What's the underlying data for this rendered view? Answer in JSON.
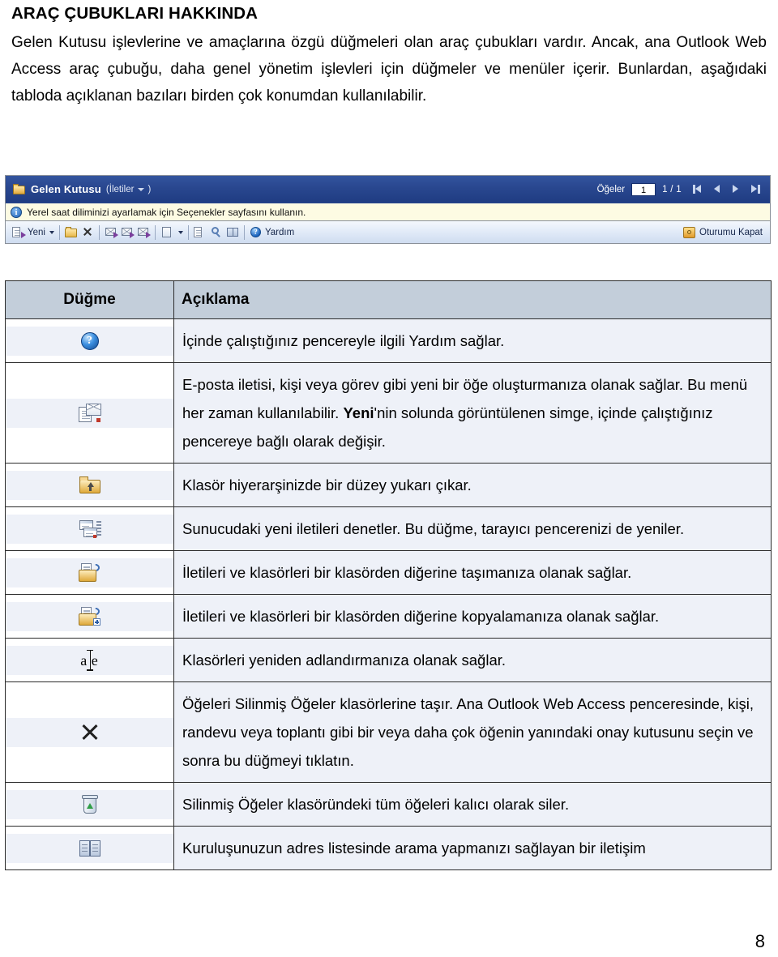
{
  "document": {
    "heading": "ARAÇ ÇUBUKLARI HAKKINDA",
    "paragraph": "Gelen Kutusu işlevlerine ve amaçlarına özgü düğmeleri olan araç çubukları vardır. Ancak, ana Outlook Web Access araç çubuğu, daha genel yönetim işlevleri için düğmeler ve menüler içerir. Bunlardan, aşağıdaki tabloda açıklanan bazıları birden çok konumdan kullanılabilir.",
    "page_number": "8"
  },
  "owa_screenshot": {
    "titlebar": {
      "folder_icon": "folder-icon",
      "title": "Gelen Kutusu",
      "view_label": "(İletiler",
      "view_close": ")",
      "items_label": "Öğeler",
      "items_value": "1",
      "page_count": "1 / 1",
      "nav_first": "first-page-button",
      "nav_prev": "previous-page-button",
      "nav_next": "next-page-button",
      "nav_last": "last-page-button"
    },
    "infobar": {
      "icon": "info-icon",
      "text": "Yerel saat diliminizi ayarlamak için Seçenekler sayfasını kullanın."
    },
    "toolbar": {
      "new_label": "Yeni",
      "help_label": "Yardım",
      "signout_label": "Oturumu Kapat",
      "buttons": [
        "new-item-button",
        "new-dropdown-caret",
        "move-to-folder-button",
        "delete-button",
        "reply-button",
        "reply-all-button",
        "forward-button",
        "reading-pane-button",
        "reading-pane-caret",
        "check-messages-button",
        "find-button",
        "address-book-button",
        "help-button"
      ]
    }
  },
  "table": {
    "headers": {
      "button": "Düğme",
      "description": "Açıklama"
    },
    "rows": [
      {
        "icon": "help-icon",
        "description": "İçinde çalıştığınız pencereyle ilgili Yardım sağlar.",
        "bold_term": "",
        "description_after_bold": ""
      },
      {
        "icon": "new-item-icon",
        "description": "E-posta iletisi, kişi veya görev gibi yeni bir öğe oluşturmanıza olanak sağlar. Bu menü her zaman kullanılabilir. ",
        "bold_term": "Yeni",
        "description_after_bold": "'nin solunda görüntülenen simge, içinde çalıştığınız pencereye bağlı olarak değişir."
      },
      {
        "icon": "folder-up-icon",
        "description": "Klasör hiyerarşinizde bir düzey yukarı çıkar.",
        "bold_term": "",
        "description_after_bold": ""
      },
      {
        "icon": "check-messages-icon",
        "description": "Sunucudaki yeni iletileri denetler. Bu düğme, tarayıcı pencerenizi de yeniler.",
        "bold_term": "",
        "description_after_bold": ""
      },
      {
        "icon": "move-to-folder-icon",
        "description": "İletileri ve klasörleri bir klasörden diğerine taşımanıza olanak sağlar.",
        "bold_term": "",
        "description_after_bold": ""
      },
      {
        "icon": "copy-to-folder-icon",
        "description": "İletileri ve klasörleri bir klasörden diğerine kopyalamanıza olanak sağlar.",
        "bold_term": "",
        "description_after_bold": ""
      },
      {
        "icon": "rename-icon",
        "description": "Klasörleri yeniden adlandırmanıza olanak sağlar.",
        "bold_term": "",
        "description_after_bold": ""
      },
      {
        "icon": "delete-icon",
        "description": "Öğeleri Silinmiş Öğeler klasörlerine taşır. Ana Outlook Web Access penceresinde, kişi, randevu veya toplantı gibi bir veya daha çok öğenin yanındaki onay kutusunu seçin ve sonra bu düğmeyi tıklatın.",
        "bold_term": "",
        "description_after_bold": ""
      },
      {
        "icon": "empty-deleted-items-icon",
        "description": "Silinmiş Öğeler klasöründeki tüm öğeleri kalıcı olarak siler.",
        "bold_term": "",
        "description_after_bold": ""
      },
      {
        "icon": "address-book-icon",
        "description": "Kuruluşunuzun adres listesinde arama yapmanızı sağlayan bir iletişim",
        "bold_term": "",
        "description_after_bold": ""
      }
    ]
  },
  "colors": {
    "titlebar_blue": "#2a4890",
    "infobar_yellow": "#fdfbe3",
    "table_header_gray": "#c3ceda",
    "table_cell_blue": "#eef1f8",
    "folder_gold": "#dfa93a"
  }
}
